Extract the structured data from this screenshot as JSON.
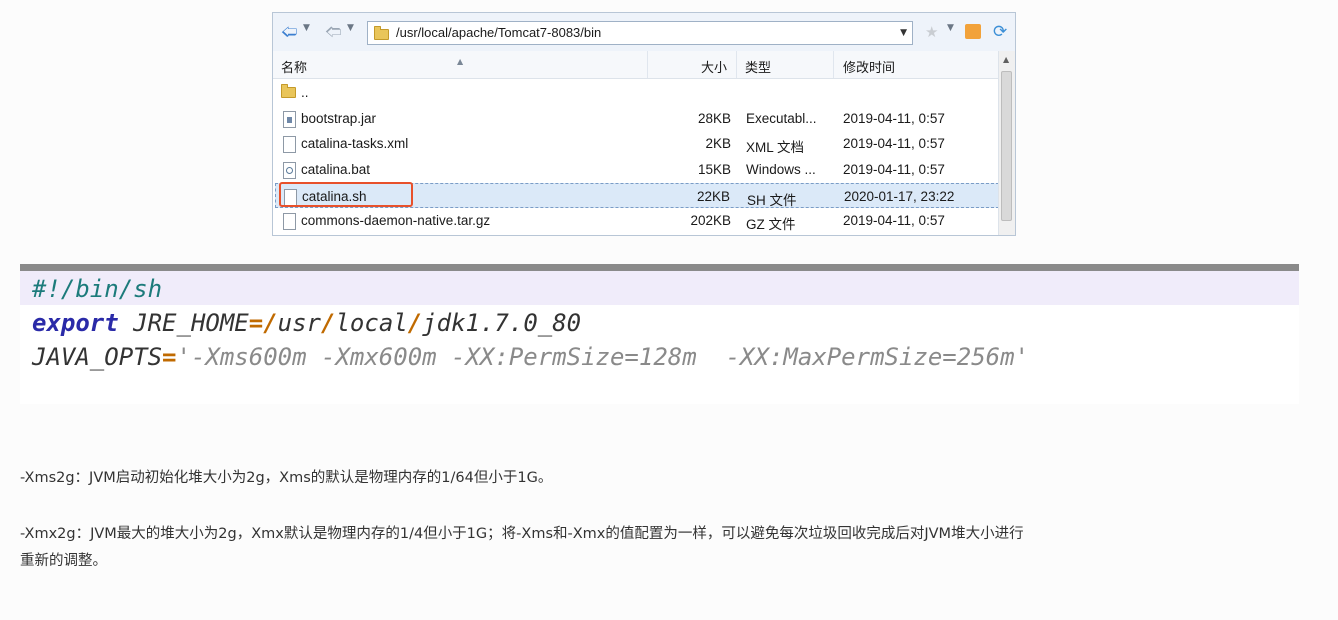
{
  "explorer": {
    "address_path": "/usr/local/apache/Tomcat7-8083/bin",
    "columns": {
      "name": "名称",
      "size": "大小",
      "type": "类型",
      "modified": "修改时间"
    },
    "parent_label": "..",
    "rows": [
      {
        "name": "bootstrap.jar",
        "size": "28KB",
        "type": "Executabl...",
        "modified": "2019-04-11, 0:57"
      },
      {
        "name": "catalina-tasks.xml",
        "size": "2KB",
        "type": "XML 文档",
        "modified": "2019-04-11, 0:57"
      },
      {
        "name": "catalina.bat",
        "size": "15KB",
        "type": "Windows ...",
        "modified": "2019-04-11, 0:57"
      },
      {
        "name": "catalina.sh",
        "size": "22KB",
        "type": "SH 文件",
        "modified": "2020-01-17, 23:22"
      },
      {
        "name": "commons-daemon-native.tar.gz",
        "size": "202KB",
        "type": "GZ 文件",
        "modified": "2019-04-11, 0:57"
      }
    ],
    "highlight_color": "#e8512b"
  },
  "code": {
    "line1": "#!/bin/sh",
    "line2": {
      "keyword": "export",
      "var": " JRE_HOME",
      "eq": "=",
      "p1": "/",
      "s1": "usr",
      "p2": "/",
      "s2": "local",
      "p3": "/",
      "s3": "jdk1.7.0_80"
    },
    "line3": {
      "var": "JAVA_OPTS",
      "eq": "=",
      "value": "'-Xms600m -Xmx600m -XX:PermSize=128m  -XX:MaxPermSize=256m'"
    }
  },
  "notes": {
    "xms": "-Xms2g：JVM启动初始化堆大小为2g，Xms的默认是物理内存的1/64但小于1G。",
    "xmx_line1": "-Xmx2g：JVM最大的堆大小为2g，Xmx默认是物理内存的1/4但小于1G；将-Xms和-Xmx的值配置为一样，可以避免每次垃圾回收完成后对JVM堆大小进行",
    "xmx_line2": "重新的调整。"
  }
}
